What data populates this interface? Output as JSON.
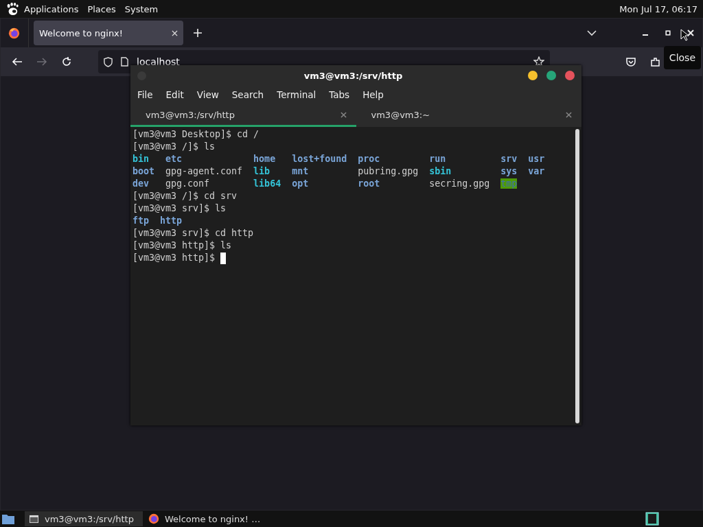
{
  "top_panel": {
    "menus": [
      "Applications",
      "Places",
      "System"
    ],
    "clock": "Mon Jul 17, 06:17"
  },
  "browser": {
    "tabs": [
      {
        "title": "Welcome to nginx!",
        "selected": true
      }
    ],
    "nav": {
      "back_disabled": false,
      "forward_disabled": true
    },
    "url": "localhost",
    "tooltip": "Close"
  },
  "terminal": {
    "title": "vm3@vm3:/srv/http",
    "menus": [
      "File",
      "Edit",
      "View",
      "Search",
      "Terminal",
      "Tabs",
      "Help"
    ],
    "tabs": [
      {
        "title": "vm3@vm3:/srv/http",
        "selected": true
      },
      {
        "title": "vm3@vm3:~",
        "selected": false
      }
    ],
    "lines": [
      {
        "kind": "input",
        "text": "[vm3@vm3 Desktop]$ cd /"
      },
      {
        "kind": "input",
        "text": "[vm3@vm3 /]$ ls"
      },
      {
        "kind": "listing",
        "columns": [
          [
            {
              "name": "bin",
              "kind": "link"
            },
            {
              "name": "boot",
              "kind": "dir"
            },
            {
              "name": "dev",
              "kind": "dir"
            }
          ],
          [
            {
              "name": "etc",
              "kind": "dir"
            },
            {
              "name": "gpg-agent.conf",
              "kind": "file"
            },
            {
              "name": "gpg.conf",
              "kind": "file"
            }
          ],
          [
            {
              "name": "home",
              "kind": "dir"
            },
            {
              "name": "lib",
              "kind": "link"
            },
            {
              "name": "lib64",
              "kind": "link"
            }
          ],
          [
            {
              "name": "lost+found",
              "kind": "dir"
            },
            {
              "name": "mnt",
              "kind": "dir"
            },
            {
              "name": "opt",
              "kind": "dir"
            }
          ],
          [
            {
              "name": "proc",
              "kind": "dir"
            },
            {
              "name": "pubring.gpg",
              "kind": "file"
            },
            {
              "name": "root",
              "kind": "dir"
            }
          ],
          [
            {
              "name": "run",
              "kind": "dir"
            },
            {
              "name": "sbin",
              "kind": "link"
            },
            {
              "name": "secring.gpg",
              "kind": "file"
            }
          ],
          [
            {
              "name": "srv",
              "kind": "dir"
            },
            {
              "name": "sys",
              "kind": "dir"
            },
            {
              "name": "tmp",
              "kind": "sticky"
            }
          ],
          [
            {
              "name": "usr",
              "kind": "dir"
            },
            {
              "name": "var",
              "kind": "dir"
            }
          ]
        ]
      },
      {
        "kind": "input",
        "text": "[vm3@vm3 /]$ cd srv"
      },
      {
        "kind": "input",
        "text": "[vm3@vm3 srv]$ ls"
      },
      {
        "kind": "listing",
        "columns": [
          [
            {
              "name": "ftp",
              "kind": "dir"
            }
          ],
          [
            {
              "name": "http",
              "kind": "dir"
            }
          ]
        ]
      },
      {
        "kind": "input",
        "text": "[vm3@vm3 srv]$ cd http"
      },
      {
        "kind": "input",
        "text": "[vm3@vm3 http]$ ls"
      },
      {
        "kind": "input",
        "text": "[vm3@vm3 http]$",
        "cursor": true
      }
    ]
  },
  "taskbar": {
    "tasks": [
      {
        "title": "vm3@vm3:/srv/http",
        "kind": "terminal",
        "selected": true
      },
      {
        "title": "Welcome to nginx! …",
        "kind": "browser",
        "selected": false
      }
    ]
  }
}
